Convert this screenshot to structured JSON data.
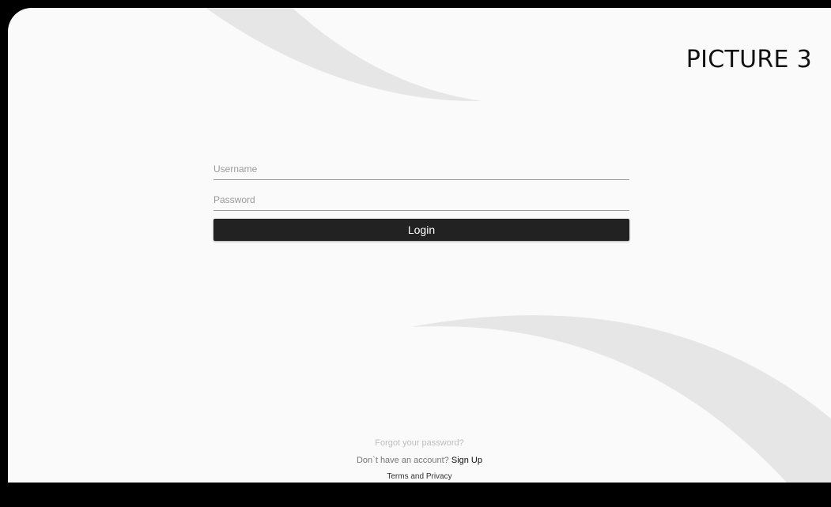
{
  "overlay_label": "PICTURE 3",
  "login_form": {
    "username_placeholder": "Username",
    "password_placeholder": "Password",
    "login_label": "Login"
  },
  "footer": {
    "forgot_password": "Forgot your password?",
    "no_account_text": "Don`t have an account?",
    "sign_up_label": "Sign Up",
    "terms_label": "Terms and Privacy"
  },
  "colors": {
    "background": "#fafafa",
    "decor_swoosh": "#e6e6e6",
    "button": "#222222",
    "frame": "#000000"
  }
}
